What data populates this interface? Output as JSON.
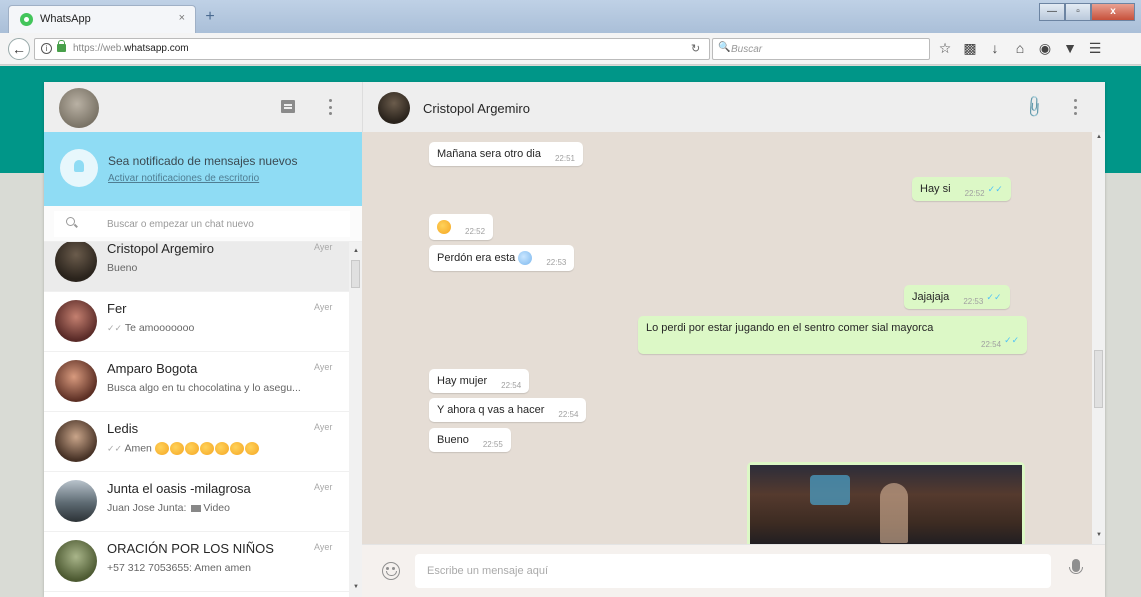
{
  "browser": {
    "tab_title": "WhatsApp",
    "tab_close": "×",
    "new_tab": "+",
    "url_prefix": "https://web.",
    "url_domain": "whatsapp.com",
    "search_placeholder": "Buscar",
    "window_buttons": [
      "—",
      "▫",
      "x"
    ],
    "toolbar_icons": [
      "star-icon",
      "bookmarks-icon",
      "download-icon",
      "home-icon",
      "pocket-icon",
      "shield-icon",
      "hamburger-menu-icon"
    ]
  },
  "colors": {
    "header_band": "#009688",
    "outgoing_bubble": "#dcf8c6",
    "notification_bg": "#8fdcf4",
    "chat_bg": "#e5ddd5"
  },
  "left": {
    "notification": {
      "title": "Sea notificado de mensajes nuevos",
      "link": "Activar notificaciones de escritorio"
    },
    "search_placeholder": "Buscar o empezar un chat nuevo",
    "chats": [
      {
        "name": "Cristopol Argemiro",
        "time": "Ayer",
        "preview": "Bueno"
      },
      {
        "name": "Fer",
        "time": "Ayer",
        "preview": "Te amooooooo"
      },
      {
        "name": "Amparo Bogota",
        "time": "Ayer",
        "preview": "Busca algo en tu chocolatina y lo asegu..."
      },
      {
        "name": "Ledis",
        "time": "Ayer",
        "preview": "Amen"
      },
      {
        "name": "Junta el oasis -milagrosa",
        "time": "Ayer",
        "preview_prefix": "Juan Jose Junta:",
        "preview": "Video"
      },
      {
        "name": "ORACIÓN POR LOS NIÑOS",
        "time": "Ayer",
        "preview": "+57 312 7053655: Amen amen"
      }
    ]
  },
  "right": {
    "contact_name": "Cristopol Argemiro",
    "messages": [
      {
        "dir": "in",
        "text": "Mañana sera otro dia",
        "time": "22:51"
      },
      {
        "dir": "out",
        "text": "Hay si",
        "time": "22:52"
      },
      {
        "dir": "in",
        "text": "",
        "time": "22:52"
      },
      {
        "dir": "in",
        "text": "Perdón era esta",
        "time": "22:53"
      },
      {
        "dir": "out",
        "text": "Jajajaja",
        "time": "22:53"
      },
      {
        "dir": "out",
        "text": "Lo perdi por estar jugando en el sentro comer sial mayorca",
        "time": "22:54"
      },
      {
        "dir": "in",
        "text": "Hay mujer",
        "time": "22:54"
      },
      {
        "dir": "in",
        "text": "Y ahora q vas a hacer",
        "time": "22:54"
      },
      {
        "dir": "in",
        "text": "Bueno",
        "time": "22:55"
      }
    ],
    "compose_placeholder": "Escribe un mensaje aquí"
  }
}
